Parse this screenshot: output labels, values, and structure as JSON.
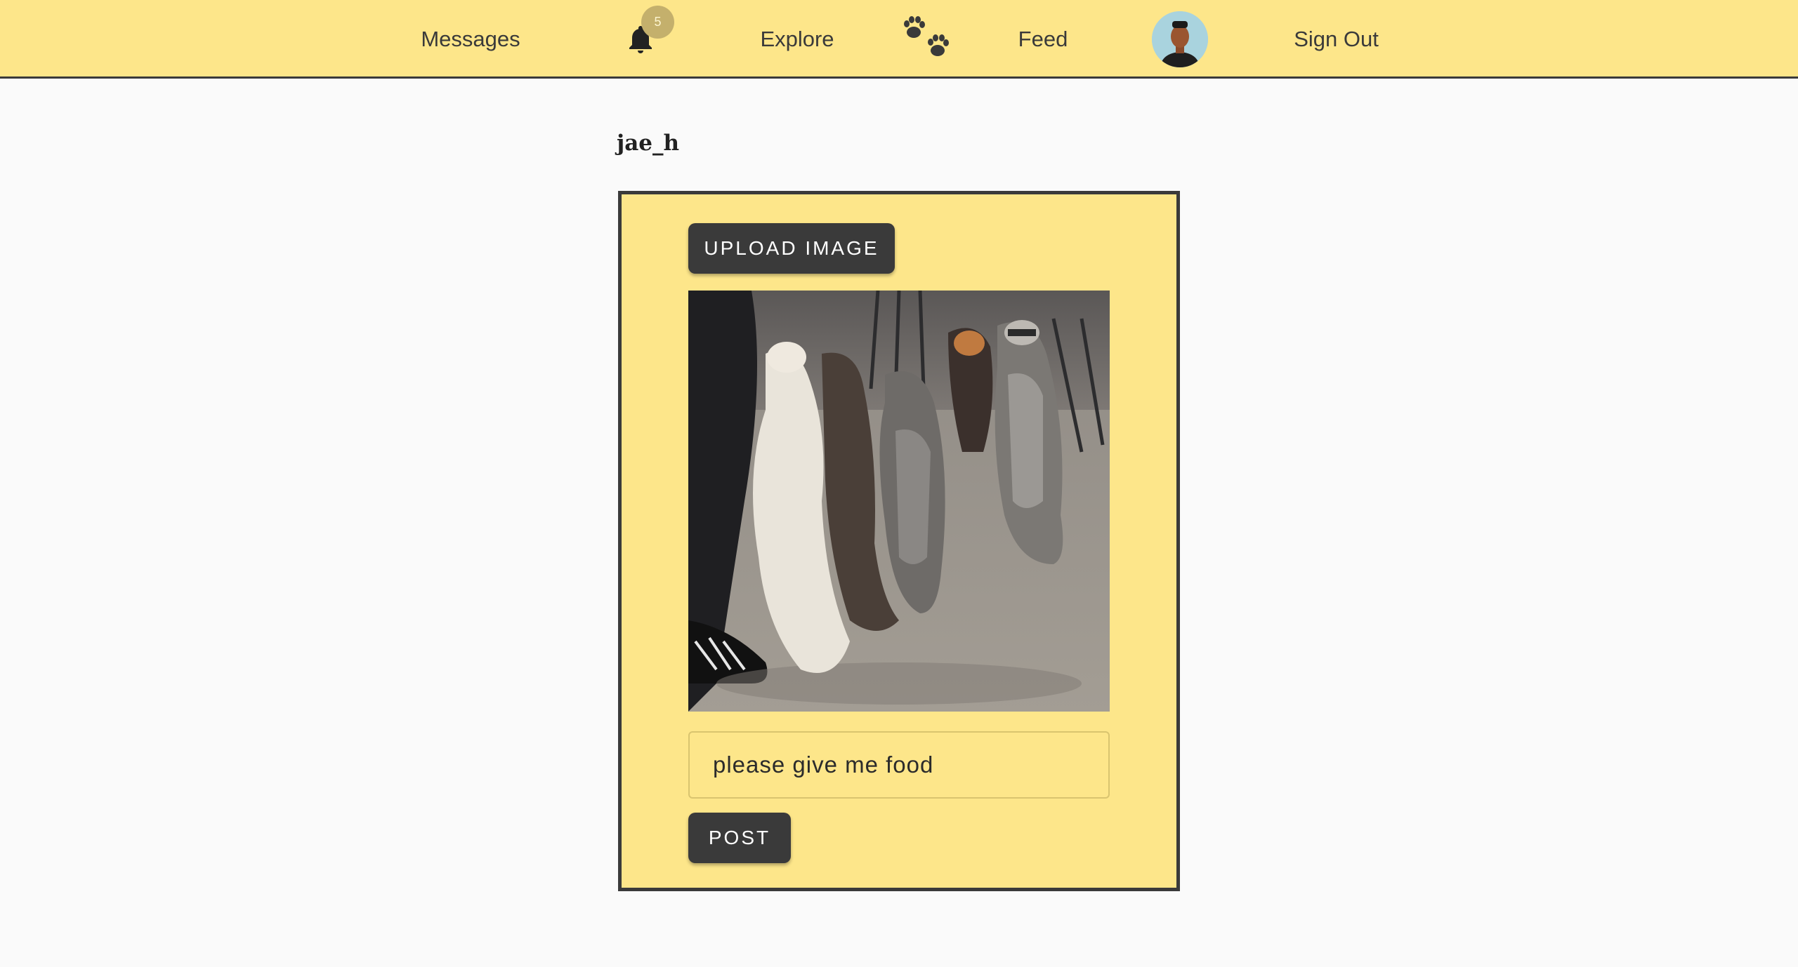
{
  "nav": {
    "messages_label": "Messages",
    "notification_count": "5",
    "explore_label": "Explore",
    "feed_label": "Feed",
    "signout_label": "Sign Out",
    "icons": [
      "bell-icon",
      "paw-icon",
      "avatar"
    ]
  },
  "profile": {
    "username": "jae_h"
  },
  "composer": {
    "upload_label": "UPLOAD IMAGE",
    "image_description": "photo-raccoons",
    "caption_value": "please give me food",
    "post_label": "POST"
  },
  "colors": {
    "navbar": "#fde68a",
    "card": "#fde68a",
    "button": "#3a3a3a",
    "badge": "#c4b06c",
    "background": "#fafafa"
  }
}
